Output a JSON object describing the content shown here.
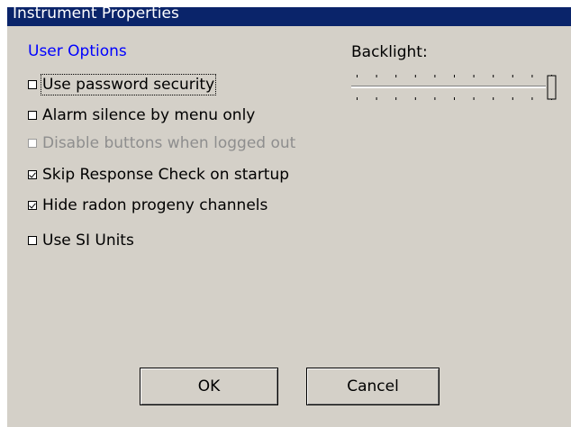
{
  "window": {
    "title": "Instrument Properties"
  },
  "user_options": {
    "label": "User Options",
    "items": [
      {
        "label": "Use password security",
        "checked": false,
        "enabled": true,
        "focused": true
      },
      {
        "label": "Alarm silence by menu only",
        "checked": false,
        "enabled": true,
        "focused": false
      },
      {
        "label": "Disable buttons when logged out",
        "checked": false,
        "enabled": false,
        "focused": false
      },
      {
        "label": "Skip Response Check on startup",
        "checked": true,
        "enabled": true,
        "focused": false
      },
      {
        "label": "Hide radon progeny channels",
        "checked": true,
        "enabled": true,
        "focused": false
      },
      {
        "label": "Use SI Units",
        "checked": false,
        "enabled": true,
        "focused": false
      }
    ]
  },
  "backlight": {
    "label": "Backlight:",
    "level_fraction": 1.0,
    "tick_count": 10
  },
  "buttons": {
    "ok": "OK",
    "cancel": "Cancel"
  },
  "colors": {
    "title_bar": "#0a246a",
    "dialog_bg": "#d4d0c8",
    "group_label": "#0000ff",
    "disabled_text": "#8e8e8e"
  }
}
